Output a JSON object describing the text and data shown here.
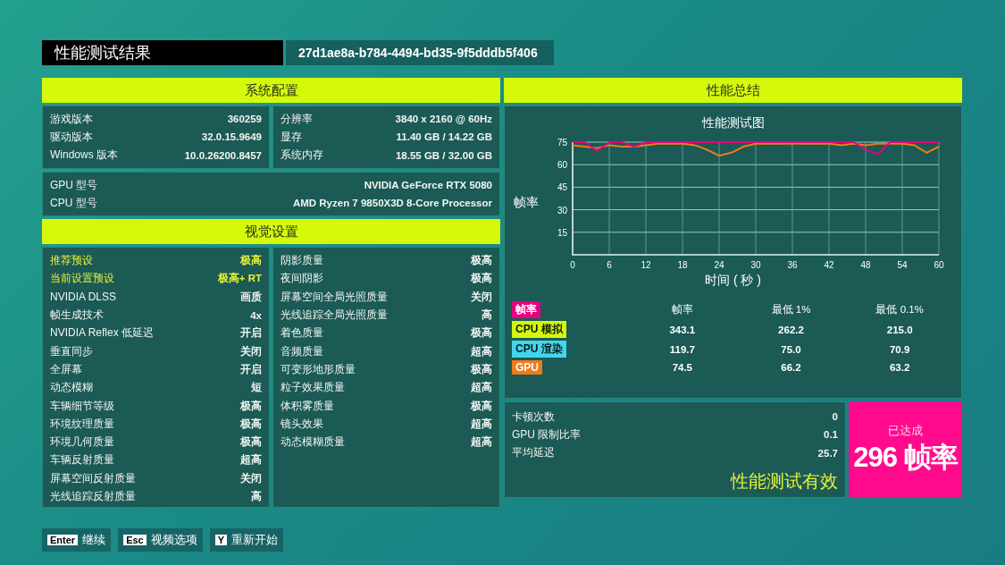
{
  "title": "性能测试结果",
  "run_id": "27d1ae8a-b784-4494-bd35-9f5dddb5f406",
  "system": {
    "heading": "系统配置",
    "left": [
      {
        "label": "游戏版本",
        "value": "360259"
      },
      {
        "label": "驱动版本",
        "value": "32.0.15.9649"
      },
      {
        "label": "Windows 版本",
        "value": "10.0.26200.8457"
      }
    ],
    "right": [
      {
        "label": "分辨率",
        "value": "3840 x 2160 @ 60Hz"
      },
      {
        "label": "显存",
        "value": "11.40 GB / 14.22 GB"
      },
      {
        "label": "系统内存",
        "value": "18.55 GB / 32.00 GB"
      }
    ],
    "hardware": [
      {
        "label": "GPU 型号",
        "value": "NVIDIA GeForce RTX 5080"
      },
      {
        "label": "CPU 型号",
        "value": "AMD Ryzen 7 9850X3D 8-Core Processor"
      }
    ]
  },
  "visual": {
    "heading": "视觉设置",
    "left": [
      {
        "label": "推荐预设",
        "value": "极高",
        "highlighted": true
      },
      {
        "label": "当前设置预设",
        "value": "极高+ RT",
        "highlighted": true
      },
      {
        "label": "NVIDIA DLSS",
        "value": "画质",
        "highlighted": false
      },
      {
        "label": "帧生成技术",
        "value": "4x",
        "highlighted": false
      },
      {
        "label": "NVIDIA Reflex 低延迟",
        "value": "开启",
        "highlighted": false
      },
      {
        "label": "垂直同步",
        "value": "关闭",
        "highlighted": false
      },
      {
        "label": "全屏幕",
        "value": "开启",
        "highlighted": false
      },
      {
        "label": "动态模糊",
        "value": "短",
        "highlighted": false
      },
      {
        "label": "车辆细节等级",
        "value": "极高",
        "highlighted": false
      },
      {
        "label": "环境纹理质量",
        "value": "极高",
        "highlighted": false
      },
      {
        "label": "环境几何质量",
        "value": "极高",
        "highlighted": false
      },
      {
        "label": "车辆反射质量",
        "value": "超高",
        "highlighted": false
      },
      {
        "label": "屏幕空间反射质量",
        "value": "关闭",
        "highlighted": false
      },
      {
        "label": "光线追踪反射质量",
        "value": "高",
        "highlighted": false
      }
    ],
    "right": [
      {
        "label": "阴影质量",
        "value": "极高",
        "highlighted": false
      },
      {
        "label": "夜间阴影",
        "value": "极高",
        "highlighted": false
      },
      {
        "label": "屏幕空间全局光照质量",
        "value": "关闭",
        "highlighted": false
      },
      {
        "label": "光线追踪全局光照质量",
        "value": "高",
        "highlighted": false
      },
      {
        "label": "着色质量",
        "value": "极高",
        "highlighted": false
      },
      {
        "label": "音频质量",
        "value": "超高",
        "highlighted": false
      },
      {
        "label": "可变形地形质量",
        "value": "极高",
        "highlighted": false
      },
      {
        "label": "粒子效果质量",
        "value": "超高",
        "highlighted": false
      },
      {
        "label": "体积雾质量",
        "value": "极高",
        "highlighted": false
      },
      {
        "label": "镜头效果",
        "value": "超高",
        "highlighted": false
      },
      {
        "label": "动态模糊质量",
        "value": "超高",
        "highlighted": false
      }
    ]
  },
  "summary": {
    "heading": "性能总结",
    "chart_data": {
      "type": "line",
      "title": "性能测试图",
      "xlabel": "时间 ( 秒 )",
      "ylabel": "帧率",
      "x": [
        0,
        2,
        4,
        6,
        8,
        10,
        12,
        14,
        16,
        18,
        20,
        22,
        24,
        26,
        28,
        30,
        32,
        34,
        36,
        38,
        40,
        42,
        44,
        46,
        48,
        50,
        52,
        54,
        56,
        58,
        60
      ],
      "grid": true,
      "xlim": [
        0,
        60
      ],
      "ylim": [
        0,
        75
      ],
      "xticks": [
        0,
        6,
        12,
        18,
        24,
        30,
        36,
        42,
        48,
        54,
        60
      ],
      "yticks": [
        15,
        30,
        45,
        60,
        75
      ],
      "series": [
        {
          "color": "#e6007e",
          "values": [
            75,
            75,
            69,
            75,
            75,
            72,
            75,
            75,
            75,
            75,
            75,
            75,
            75,
            75,
            75,
            75,
            75,
            75,
            75,
            75,
            75,
            75,
            75,
            75,
            70,
            67,
            75,
            75,
            75,
            75,
            75
          ]
        },
        {
          "color": "#f07a1a",
          "values": [
            73,
            72,
            71,
            73,
            72,
            72,
            73,
            74,
            74,
            74,
            73,
            70,
            66,
            68,
            72,
            74,
            74,
            74,
            74,
            74,
            74,
            74,
            73,
            74,
            73,
            74,
            74,
            74,
            73,
            68,
            72
          ]
        }
      ]
    },
    "fps_table": {
      "key": {
        "label": "帧率",
        "color": "#e6007e"
      },
      "columns": [
        "帧率",
        "最低 1%",
        "最低 0.1%"
      ],
      "rows": [
        {
          "label": "CPU 模拟",
          "color": "#d4f70a",
          "values": [
            "343.1",
            "262.2",
            "215.0"
          ]
        },
        {
          "label": "CPU 渲染",
          "color": "#3fd6ee",
          "values": [
            "119.7",
            "75.0",
            "70.9"
          ]
        },
        {
          "label": "GPU",
          "color": "#f07a1a",
          "values": [
            "74.5",
            "66.2",
            "63.2"
          ]
        }
      ]
    },
    "stats": [
      {
        "label": "卡顿次数",
        "value": "0"
      },
      {
        "label": "GPU 限制比率",
        "value": "0.1"
      },
      {
        "label": "平均延迟",
        "value": "25.7"
      }
    ],
    "verdict": "性能测试有效",
    "achieved": {
      "caption": "已达成",
      "value": "296 帧率"
    }
  },
  "hints": [
    {
      "key": "Enter",
      "label": "继续"
    },
    {
      "key": "Esc",
      "label": "视频选项"
    },
    {
      "key": "Y",
      "label": "重新开始"
    }
  ]
}
